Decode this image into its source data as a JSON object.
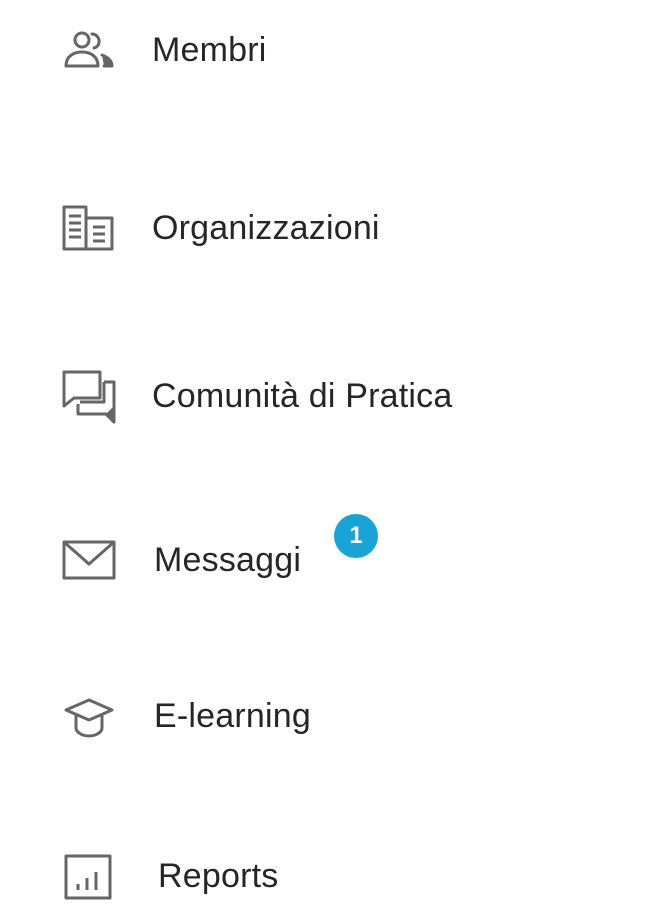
{
  "menu": {
    "items": [
      {
        "label": "Membri",
        "icon": "members-icon"
      },
      {
        "label": "Organizzazioni",
        "icon": "organizations-icon"
      },
      {
        "label": "Comunità di Pratica",
        "icon": "chat-bubbles-icon"
      },
      {
        "label": "Messaggi",
        "icon": "envelope-icon",
        "badge": "1"
      },
      {
        "label": "E-learning",
        "icon": "graduation-cap-icon"
      },
      {
        "label": "Reports",
        "icon": "bar-chart-icon"
      }
    ]
  },
  "colors": {
    "icon": "#666666",
    "text": "#262626",
    "badge": "#1aa3d6",
    "badge_text": "#ffffff",
    "background": "#ffffff"
  }
}
